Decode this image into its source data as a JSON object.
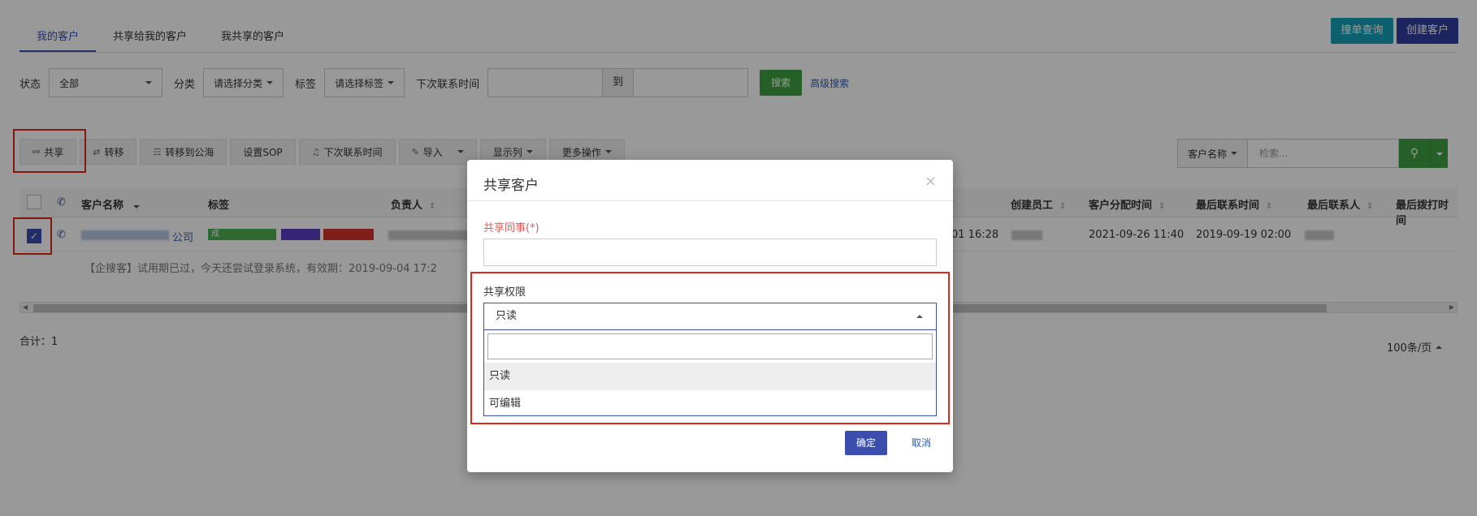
{
  "tabs": [
    {
      "label": "我的客户"
    },
    {
      "label": "共享给我的客户"
    },
    {
      "label": "我共享的客户"
    }
  ],
  "top_buttons": {
    "query": "撞单查询",
    "create": "创建客户"
  },
  "filters": {
    "status_label": "状态",
    "status_value": "全部",
    "category_label": "分类",
    "category_value": "请选择分类",
    "tag_label": "标签",
    "tag_value": "请选择标签",
    "next_contact_label": "下次联系时间",
    "to_label": "到",
    "search_button": "搜索",
    "advanced_link": "高级搜索"
  },
  "toolbar": {
    "share": "共享",
    "transfer": "转移",
    "to_pool": "转移到公海",
    "set_sop": "设置SOP",
    "next_contact": "下次联系时间",
    "import": "导入",
    "columns": "显示列",
    "more": "更多操作"
  },
  "search_group": {
    "field": "客户名称",
    "placeholder": "检索..."
  },
  "table": {
    "headers": {
      "name": "客户名称",
      "tags": "标签",
      "owner": "负责人",
      "creator": "创建员工",
      "assign_time": "客户分配时间",
      "last_contact_time": "最后联系时间",
      "last_contact_person": "最后联系人",
      "last_call_time": "最后拨打时间"
    },
    "row": {
      "name_suffix": "公司",
      "tag_green": "成",
      "created_time_partial": "01 16:28",
      "assign_time": "2021-09-26 11:40",
      "last_contact_time": "2019-09-19 02:00"
    },
    "note": "【企搜客】试用期已过，今天还尝试登录系统，有效期：2019-09-04 17:2"
  },
  "footer": {
    "total": "合计：1",
    "page_size": "100条/页"
  },
  "modal": {
    "title": "共享客户",
    "close": "×",
    "colleague_label": "共享同事(*)",
    "permission_label": "共享权限",
    "permission_value": "只读",
    "options": [
      "只读",
      "可编辑"
    ],
    "ok": "确定",
    "cancel": "取消"
  },
  "colors": {
    "accent": "#3b4eb0",
    "success": "#3fa143",
    "teal": "#17a2b8",
    "highlight": "#e0261b"
  }
}
